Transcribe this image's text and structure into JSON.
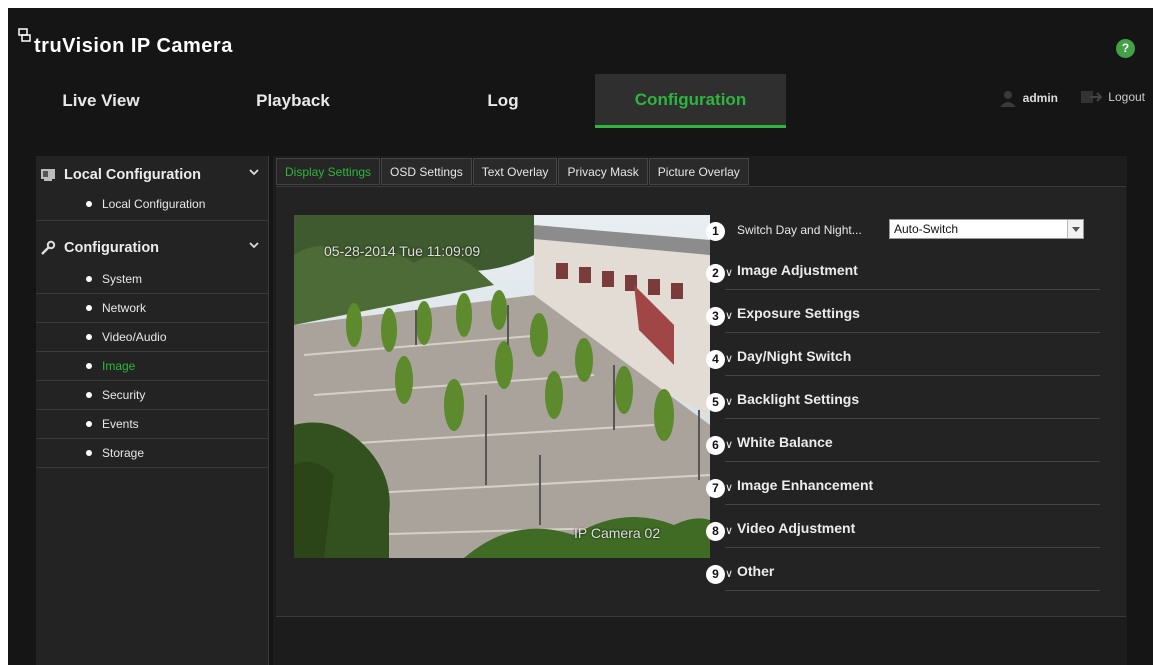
{
  "app": {
    "title": "truVision IP Camera",
    "help_label": "?"
  },
  "topnav": {
    "tabs": [
      {
        "label": "Live View"
      },
      {
        "label": "Playback"
      },
      {
        "label": "Log"
      },
      {
        "label": "Configuration",
        "active": true
      }
    ],
    "user": "admin",
    "logout": "Logout"
  },
  "sidebar": {
    "local_section": "Local Configuration",
    "local_items": [
      {
        "label": "Local Configuration"
      }
    ],
    "config_section": "Configuration",
    "config_items": [
      {
        "label": "System"
      },
      {
        "label": "Network"
      },
      {
        "label": "Video/Audio"
      },
      {
        "label": "Image",
        "active": true
      },
      {
        "label": "Security"
      },
      {
        "label": "Events"
      },
      {
        "label": "Storage"
      }
    ]
  },
  "subtabs": [
    {
      "label": "Display Settings",
      "active": true
    },
    {
      "label": "OSD Settings"
    },
    {
      "label": "Text Overlay"
    },
    {
      "label": "Privacy Mask"
    },
    {
      "label": "Picture Overlay"
    }
  ],
  "video": {
    "osd_datetime": "05-28-2014 Tue 11:09:09",
    "camera_name": "IP Camera 02"
  },
  "settings": {
    "switch_label": "Switch Day and Night...",
    "switch_value": "Auto-Switch",
    "sections": [
      {
        "number": "2",
        "label": "Image Adjustment"
      },
      {
        "number": "3",
        "label": "Exposure Settings"
      },
      {
        "number": "4",
        "label": "Day/Night Switch"
      },
      {
        "number": "5",
        "label": "Backlight Settings"
      },
      {
        "number": "6",
        "label": "White Balance"
      },
      {
        "number": "7",
        "label": "Image Enhancement"
      },
      {
        "number": "8",
        "label": "Video Adjustment"
      },
      {
        "number": "9",
        "label": "Other"
      }
    ],
    "switch_number": "1"
  },
  "colors": {
    "accent": "#2fb53e",
    "background": "#151515",
    "panel": "#232323"
  }
}
